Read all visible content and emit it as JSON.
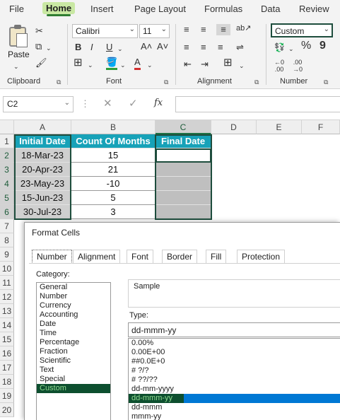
{
  "ribbon_tabs": [
    "File",
    "Home",
    "Insert",
    "Page Layout",
    "Formulas",
    "Data",
    "Review"
  ],
  "ribbon": {
    "clipboard": {
      "paste_label": "Paste",
      "group_label": "Clipboard"
    },
    "font": {
      "font_name": "Calibri",
      "font_size": "11",
      "group_label": "Font"
    },
    "alignment": {
      "group_label": "Alignment"
    },
    "number": {
      "format_value": "Custom",
      "group_label": "Number"
    }
  },
  "formula_bar": {
    "name_box": "C2",
    "fx_symbol": "fx",
    "content": ""
  },
  "columns": [
    "A",
    "B",
    "C",
    "D",
    "E",
    "F"
  ],
  "rows": [
    "1",
    "2",
    "3",
    "4",
    "5",
    "6",
    "7",
    "8",
    "9",
    "10",
    "11",
    "12",
    "13",
    "14",
    "15",
    "16",
    "17",
    "18",
    "19",
    "20"
  ],
  "table": {
    "headers": [
      "Initial Date",
      "Count Of Months",
      "Final Date"
    ],
    "rows": [
      [
        "18-Mar-23",
        "15",
        ""
      ],
      [
        "20-Apr-23",
        "21",
        ""
      ],
      [
        "23-May-23",
        "-10",
        ""
      ],
      [
        "15-Jun-23",
        "5",
        ""
      ],
      [
        "30-Jul-23",
        "3",
        ""
      ]
    ]
  },
  "dialog": {
    "title": "Format Cells",
    "tabs": [
      "Number",
      "Alignment",
      "Font",
      "Border",
      "Fill",
      "Protection"
    ],
    "active_tab": "Number",
    "category_label": "Category:",
    "categories": [
      "General",
      "Number",
      "Currency",
      "Accounting",
      "Date",
      "Time",
      "Percentage",
      "Fraction",
      "Scientific",
      "Text",
      "Special",
      "Custom"
    ],
    "selected_category": "Custom",
    "sample_label": "Sample",
    "type_label": "Type:",
    "type_value": "dd-mmm-yy",
    "formats": [
      "0.00%",
      "0.00E+00",
      "##0.0E+0",
      "# ?/?",
      "# ??/??",
      "dd-mm-yyyy",
      "dd-mmm-yy",
      "dd-mmm",
      "mmm-yy"
    ],
    "selected_format": "dd-mmm-yy"
  },
  "colors": {
    "header_fill": "#17a2b8",
    "accent_green": "#1e7145",
    "selection_border": "#1e4d3d",
    "highlight_blue": "#0078d4"
  }
}
